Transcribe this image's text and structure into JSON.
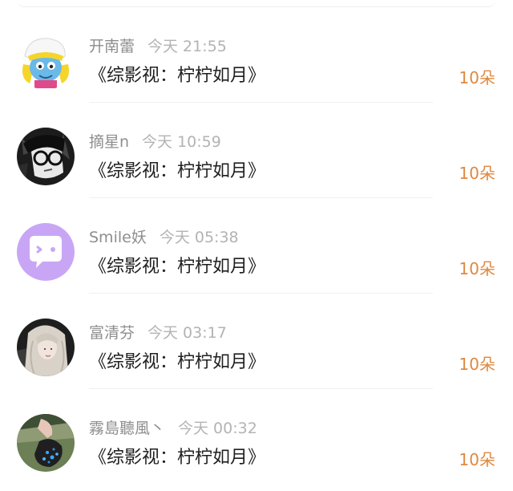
{
  "items": [
    {
      "name": "开南蕾",
      "time": "今天 21:55",
      "book": "《综影视：柠柠如月》",
      "gift": "10朵",
      "avatar_icon": "smurf-avatar-icon"
    },
    {
      "name": "摘星n",
      "time": "今天 10:59",
      "book": "《综影视：柠柠如月》",
      "gift": "10朵",
      "avatar_icon": "anime-glasses-avatar-icon"
    },
    {
      "name": "Smile妖",
      "time": "今天 05:38",
      "book": "《综影视：柠柠如月》",
      "gift": "10朵",
      "avatar_icon": "chat-bubble-avatar-icon"
    },
    {
      "name": "富清芬",
      "time": "今天 03:17",
      "book": "《综影视：柠柠如月》",
      "gift": "10朵",
      "avatar_icon": "girl-portrait-avatar-icon"
    },
    {
      "name": "霧島聽風丶",
      "time": "今天 00:32",
      "book": "《综影视：柠柠如月》",
      "gift": "10朵",
      "avatar_icon": "hand-photo-avatar-icon"
    }
  ],
  "colors": {
    "gift_accent": "#e0883f",
    "name_text": "#8e8e8e",
    "time_text": "#b3b3b3",
    "title_text": "#1f1f1f",
    "chat_avatar_bg": "#c9a6f5"
  }
}
